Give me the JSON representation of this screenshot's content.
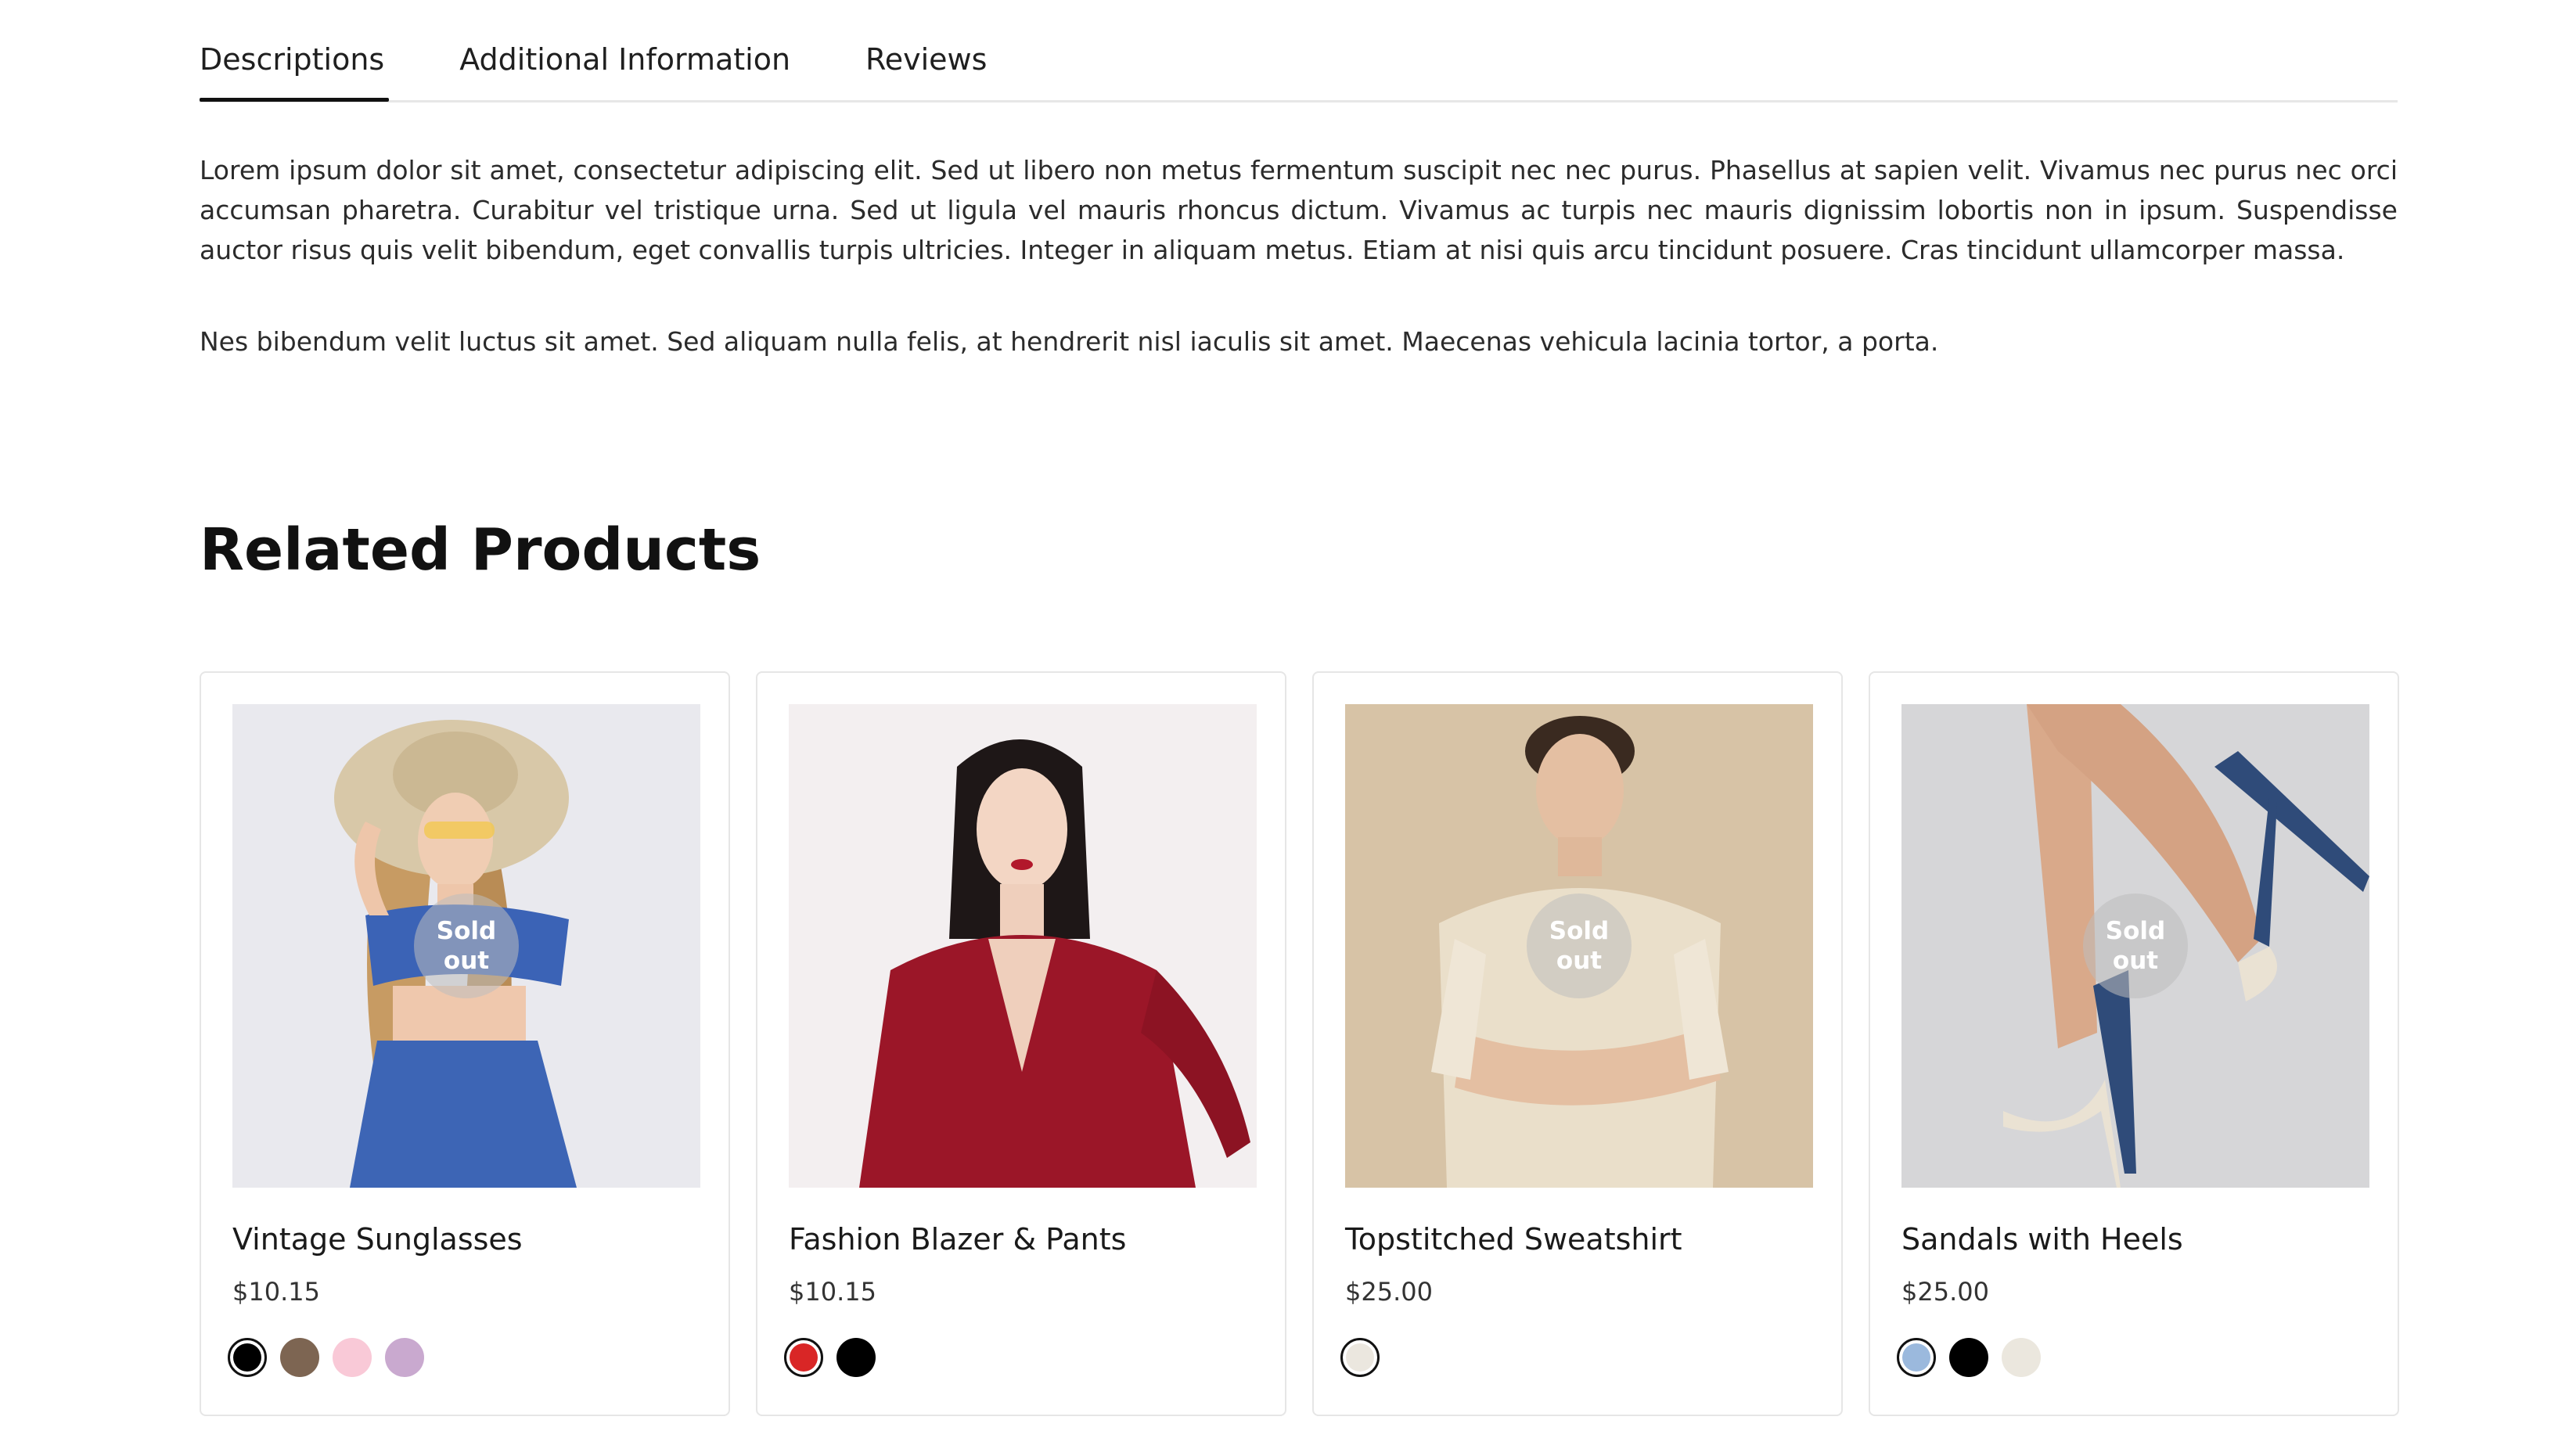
{
  "tabs": [
    {
      "label": "Descriptions",
      "active": true
    },
    {
      "label": "Additional Information",
      "active": false
    },
    {
      "label": "Reviews",
      "active": false
    }
  ],
  "description": {
    "paragraph_1": "Lorem ipsum dolor sit amet, consectetur adipiscing elit. Sed ut libero non metus fermentum suscipit nec nec purus. Phasellus at sapien velit. Vivamus nec purus nec orci accumsan pharetra. Curabitur vel tristique urna. Sed ut ligula vel mauris rhoncus dictum. Vivamus ac turpis nec mauris dignissim lobortis non in ipsum. Suspendisse auctor risus quis velit bibendum, eget convallis turpis ultricies. Integer in aliquam metus. Etiam at nisi quis arcu tincidunt posuere. Cras tincidunt ullamcorper massa.",
    "paragraph_2": "Nes bibendum velit luctus sit amet. Sed aliquam nulla felis, at hendrerit nisl iaculis sit amet. Maecenas vehicula lacinia tortor, a porta."
  },
  "related": {
    "title": "Related Products",
    "sold_out_line1": "Sold",
    "sold_out_line2": "out",
    "products": [
      {
        "name": "Vintage Sunglasses",
        "price": "$10.15",
        "sold_out": true,
        "image_icon": "woman-in-sun-hat-photo",
        "colors": [
          "#000000",
          "#7d6552",
          "#f9c9d7",
          "#c9a9cf"
        ],
        "selected_color": 0
      },
      {
        "name": "Fashion Blazer & Pants",
        "price": "$10.15",
        "sold_out": false,
        "image_icon": "woman-in-red-blazer-photo",
        "colors": [
          "#d92626",
          "#000000"
        ],
        "selected_color": 0
      },
      {
        "name": "Topstitched Sweatshirt",
        "price": "$25.00",
        "sold_out": true,
        "image_icon": "man-in-beige-shirt-photo",
        "colors": [
          "#ebe7df"
        ],
        "selected_color": 0
      },
      {
        "name": "Sandals with Heels",
        "price": "$25.00",
        "sold_out": true,
        "image_icon": "high-heel-sandals-photo",
        "colors": [
          "#9bb9dd",
          "#000000",
          "#ebe7de"
        ],
        "selected_color": 0
      }
    ]
  }
}
